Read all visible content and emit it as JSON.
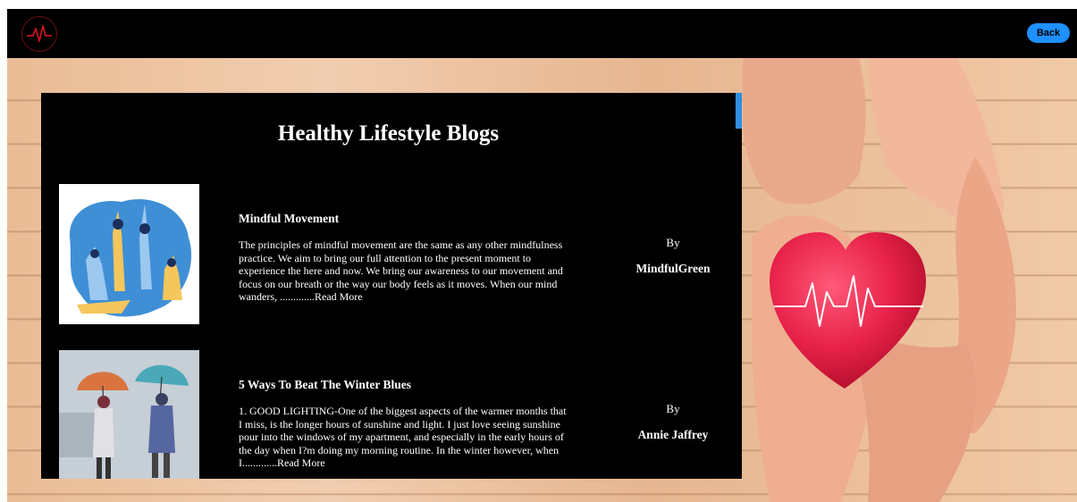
{
  "header": {
    "back_label": "Back",
    "logo_icon": "heartbeat-logo-icon"
  },
  "main": {
    "title": "Healthy Lifestyle Blogs",
    "posts": [
      {
        "title": "Mindful Movement",
        "excerpt": "The principles of mindful movement are the same as any other mindfulness practice. We aim to bring our full attention to the present moment to experience the here and now. We bring our awareness to our movement and focus on our breath or the way our body feels as it moves. When our mind wanders, .............",
        "read_more": "Read More",
        "by": "By",
        "author": "MindfulGreen",
        "image_icon": "yoga-illustration"
      },
      {
        "title": "5 Ways To Beat The Winter Blues",
        "excerpt": "1. GOOD LIGHTING-One of the biggest aspects of the warmer months that I miss, is the longer hours of sunshine and light. I just love seeing sunshine pour into the windows of my apartment, and especially in the early hours of the day when I?m doing my morning routine. In the winter however, when I.............",
        "read_more": "Read More",
        "by": "By",
        "author": "Annie Jaffrey",
        "image_icon": "winter-umbrella-photo"
      }
    ]
  },
  "colors": {
    "topbar": "#000000",
    "accent": "#1e90ff",
    "panel": "#000000",
    "heart": "#e8224a"
  }
}
